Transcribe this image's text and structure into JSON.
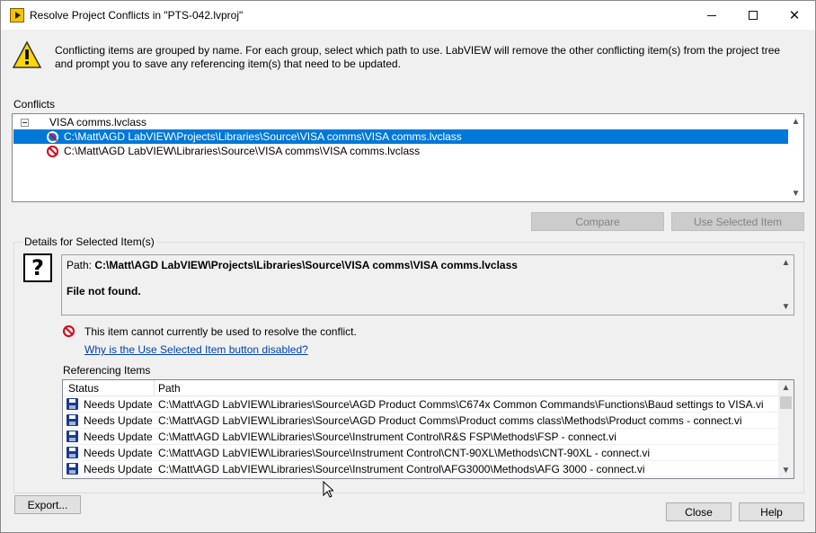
{
  "window": {
    "title": "Resolve Project Conflicts in \"PTS-042.lvproj\"",
    "controls": {
      "minimize": "minimize",
      "maximize": "maximize",
      "close": "✕"
    }
  },
  "intro_text": "Conflicting items are grouped by name.  For each group, select which path to use.  LabVIEW will remove the other conflicting item(s) from the project tree and prompt you to save any referencing item(s) that need to be updated.",
  "conflicts": {
    "label": "Conflicts",
    "group_name": "VISA comms.lvclass",
    "items": [
      {
        "path": "C:\\Matt\\AGD LabVIEW\\Projects\\Libraries\\Source\\VISA comms\\VISA comms.lvclass",
        "selected": true
      },
      {
        "path": "C:\\Matt\\AGD LabVIEW\\Libraries\\Source\\VISA comms\\VISA comms.lvclass",
        "selected": false
      }
    ]
  },
  "buttons": {
    "compare": "Compare",
    "use_selected": "Use Selected Item",
    "export": "Export...",
    "close": "Close",
    "help": "Help"
  },
  "details": {
    "group_label": "Details for Selected Item(s)",
    "path_label": "Path: ",
    "path_value": "C:\\Matt\\AGD LabVIEW\\Projects\\Libraries\\Source\\VISA comms\\VISA comms.lvclass",
    "status_text": "File not found.",
    "cannot_use_msg": "This item cannot currently be used to resolve the conflict.",
    "why_link": "Why is the Use Selected Item button disabled?"
  },
  "referencing": {
    "label": "Referencing Items",
    "columns": [
      "Status",
      "Path"
    ],
    "rows": [
      {
        "status": "Needs Update",
        "path": "C:\\Matt\\AGD LabVIEW\\Libraries\\Source\\AGD Product Comms\\C674x Common Commands\\Functions\\Baud settings to VISA.vi"
      },
      {
        "status": "Needs Update",
        "path": "C:\\Matt\\AGD LabVIEW\\Libraries\\Source\\AGD Product Comms\\Product comms class\\Methods\\Product comms - connect.vi"
      },
      {
        "status": "Needs Update",
        "path": "C:\\Matt\\AGD LabVIEW\\Libraries\\Source\\Instrument Control\\R&S FSP\\Methods\\FSP - connect.vi"
      },
      {
        "status": "Needs Update",
        "path": "C:\\Matt\\AGD LabVIEW\\Libraries\\Source\\Instrument Control\\CNT-90XL\\Methods\\CNT-90XL - connect.vi"
      },
      {
        "status": "Needs Update",
        "path": "C:\\Matt\\AGD LabVIEW\\Libraries\\Source\\Instrument Control\\AFG3000\\Methods\\AFG 3000 - connect.vi"
      }
    ]
  },
  "icons": {
    "app": "labview-icon",
    "warning": "warning-icon",
    "no_entry": "no-entry-icon",
    "question": "?",
    "save": "floppy-disk-icon"
  },
  "colors": {
    "selection": "#0078d7",
    "link": "#0044aa",
    "error": "#d9001b"
  }
}
